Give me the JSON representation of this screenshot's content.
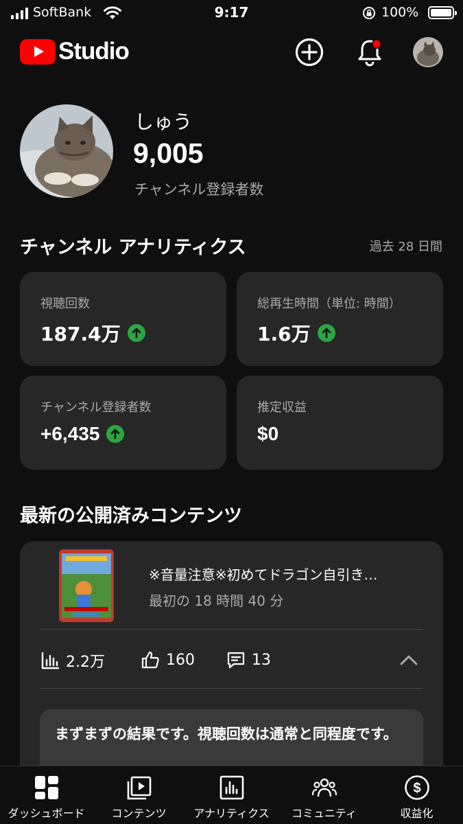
{
  "status_bar": {
    "carrier": "SoftBank",
    "time": "9:17",
    "battery": "100%"
  },
  "header": {
    "logo_text": "Studio",
    "brand_color": "#ff0000",
    "notification_dot_color": "#ff0000"
  },
  "channel": {
    "name": "しゅう",
    "subscribers": "9,005",
    "subscribers_label": "チャンネル登録者数"
  },
  "analytics": {
    "title": "チャンネル アナリティクス",
    "period": "過去 28 日間",
    "cards": [
      {
        "label": "視聴回数",
        "value": "187.4万",
        "trend": "up"
      },
      {
        "label": "総再生時間（単位: 時間）",
        "value": "1.6万",
        "trend": "up"
      },
      {
        "label": "チャンネル登録者数",
        "value": "+6,435",
        "trend": "up"
      },
      {
        "label": "推定収益",
        "value": "$0",
        "trend": "none"
      }
    ],
    "trend_up_color": "#2ba640"
  },
  "latest_content": {
    "title": "最新の公開済みコンテンツ",
    "video": {
      "title": "※音量注意※初めてドラゴン自引き…",
      "subtitle": "最初の 18 時間 40 分",
      "views": "2.2万",
      "likes": "160",
      "comments": "13"
    },
    "insight": "まずまずの結果です。視聴回数は通常と同程度です。"
  },
  "bottom_nav": [
    {
      "label": "ダッシュボード",
      "icon": "dashboard-icon"
    },
    {
      "label": "コンテンツ",
      "icon": "content-icon"
    },
    {
      "label": "アナリティクス",
      "icon": "analytics-icon"
    },
    {
      "label": "コミュニティ",
      "icon": "community-icon"
    },
    {
      "label": "収益化",
      "icon": "monetization-icon"
    }
  ]
}
